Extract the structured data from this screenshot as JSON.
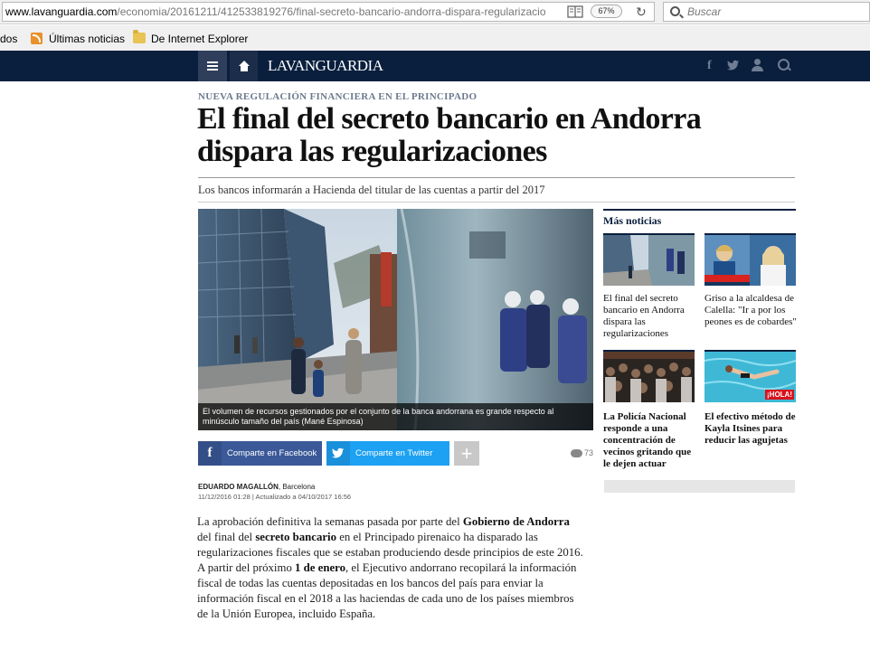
{
  "browser": {
    "url_host": "www.lavanguardia.com",
    "url_path": "/economia/20161211/412533819276/final-secreto-bancario-andorra-dispara-regularizacio",
    "zoom": "67%",
    "search_placeholder": "Buscar",
    "bookmarks": [
      {
        "label": "dos"
      },
      {
        "label": "Últimas noticias"
      },
      {
        "label": "De Internet Explorer"
      }
    ]
  },
  "site": {
    "logo": "LAVANGUARDIA",
    "nav_icons": [
      "menu-icon",
      "home-icon",
      "facebook-icon",
      "twitter-icon",
      "user-icon",
      "search-icon"
    ],
    "colors": {
      "header_bg": "#0a1f3d",
      "facebook": "#3b5998",
      "twitter": "#1da1f2"
    }
  },
  "article": {
    "kicker": "NUEVA REGULACIÓN FINANCIERA EN EL PRINCIPADO",
    "title": "El final del secreto bancario en Andorra dispara las regularizaciones",
    "subtitle": "Los bancos informarán a Hacienda del titular de las cuentas a partir del 2017",
    "caption": "El volumen de recursos gestionados por el conjunto de la banca andorrana es grande respecto al minúsculo tamaño del país (Mané Espinosa)",
    "share_facebook": "Comparte en Facebook",
    "share_twitter": "Comparte en Twitter",
    "plus": "+",
    "comments": "73",
    "author": "EDUARDO MAGALLÓN",
    "location": ", Barcelona",
    "dates": "11/12/2016 01:28 | Actualizado a 04/10/2017 16:56",
    "body": [
      {
        "t": "La aprobación definitiva la semanas pasada por parte del ",
        "b": false
      },
      {
        "t": "Gobierno de Andorra",
        "b": true
      },
      {
        "t": " del final del ",
        "b": false
      },
      {
        "t": "secreto bancario",
        "b": true
      },
      {
        "t": " en el Principado pirenaico ha disparado las regularizaciones fiscales que se estaban produciendo desde principios de este 2016. A partir del próximo ",
        "b": false
      },
      {
        "t": "1 de enero",
        "b": true
      },
      {
        "t": ", el Ejecutivo andorrano recopilará la información fiscal de todas las cuentas depositadas en los bancos del país para enviar la información fiscal en el 2018 a las haciendas de cada uno de los países miembros de la Unión Europea, incluido España.",
        "b": false
      }
    ]
  },
  "sidebar": {
    "title": "Más noticias",
    "items": [
      {
        "text": "El final del secreto bancario en Andorra dispara las regularizaciones",
        "bold": false
      },
      {
        "text": "Griso a la alcaldesa de Calella: \"Ir a por los peones es de cobardes\"",
        "bold": false
      },
      {
        "text": "La Policía Nacional responde a una concentración de vecinos gritando que le dejen actuar",
        "bold": true
      },
      {
        "text": "El efectivo método de Kayla Itsines para reducir las agujetas",
        "bold": true,
        "tag": "¡HOLA!"
      }
    ]
  }
}
